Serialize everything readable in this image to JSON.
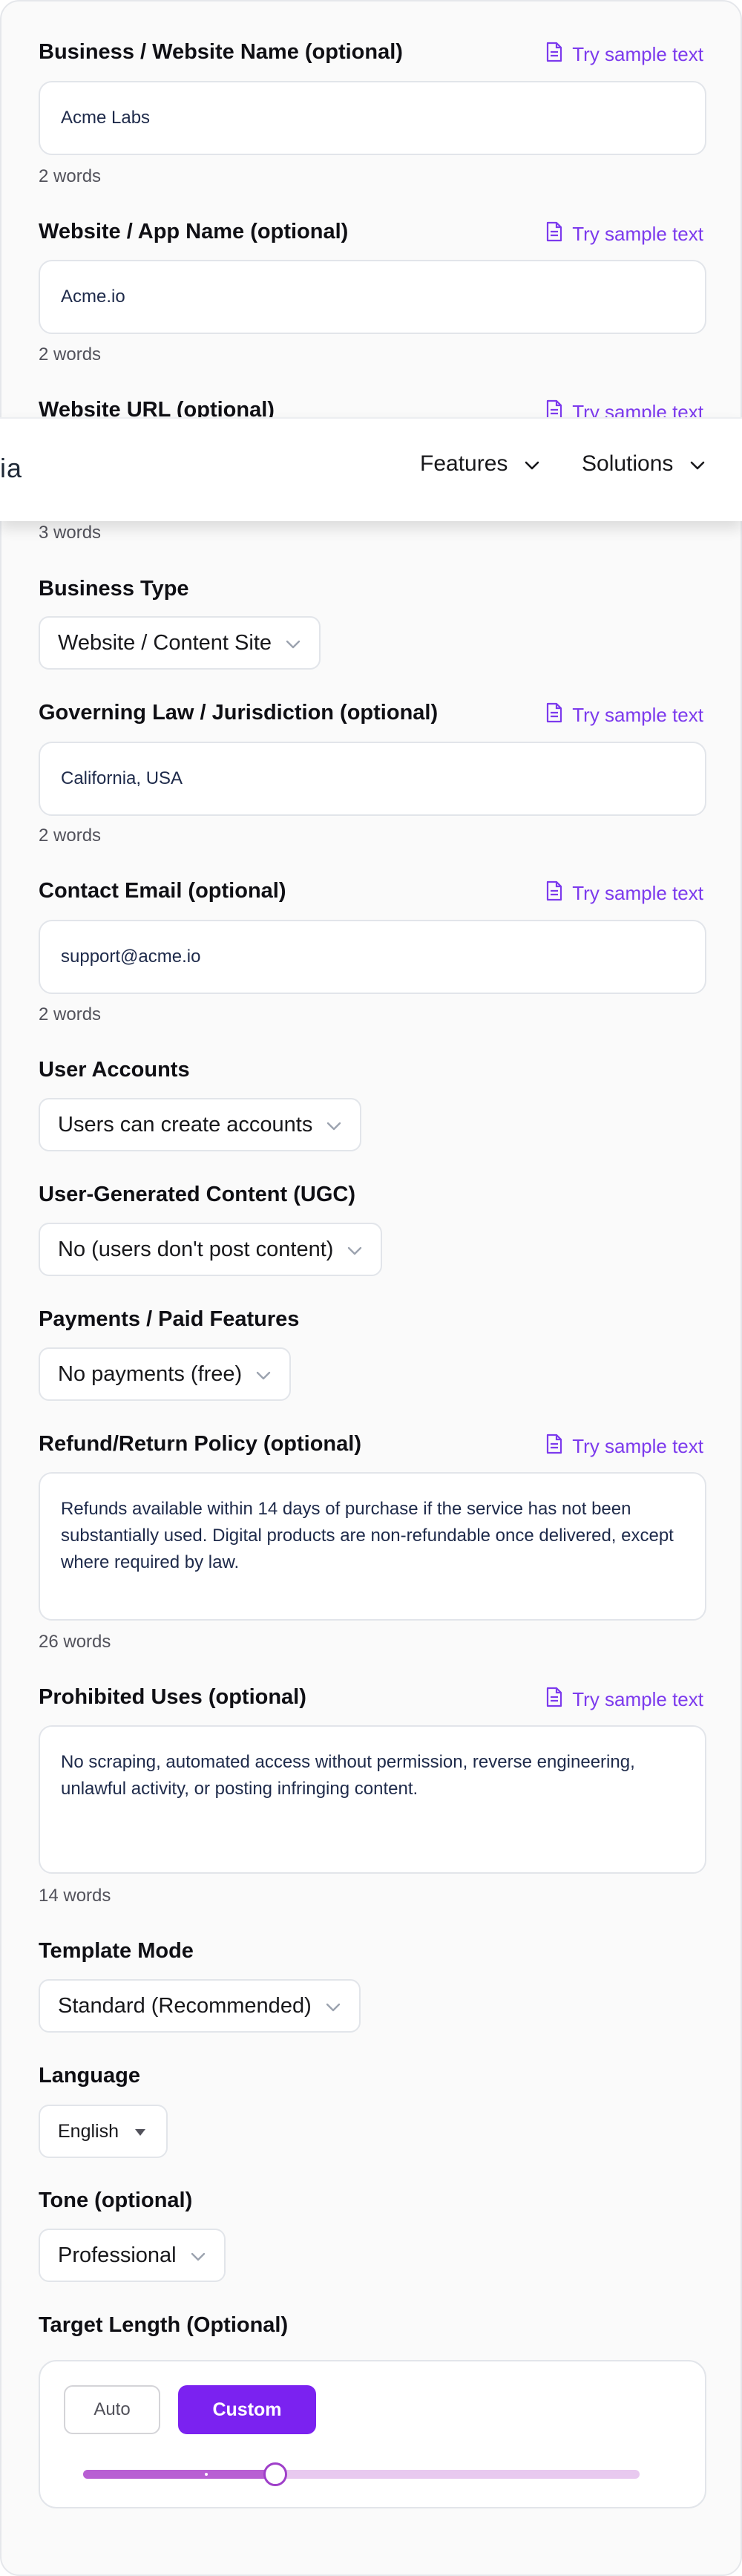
{
  "sample_link_label": "Try sample text",
  "accent_color": "#7c3aed",
  "fields": {
    "business_name": {
      "label": "Business / Website Name (optional)",
      "value": "Acme Labs",
      "words": "2 words"
    },
    "app_name": {
      "label": "Website / App Name (optional)",
      "value": "Acme.io",
      "words": "2 words"
    },
    "website_url": {
      "label": "Website URL (optional)",
      "words": "3 words"
    },
    "business_type": {
      "label": "Business Type",
      "value": "Website / Content Site"
    },
    "governing_law": {
      "label": "Governing Law / Jurisdiction (optional)",
      "value": "California, USA",
      "words": "2 words"
    },
    "contact_email": {
      "label": "Contact Email (optional)",
      "value": "support@acme.io",
      "words": "2 words"
    },
    "user_accounts": {
      "label": "User Accounts",
      "value": "Users can create accounts"
    },
    "ugc": {
      "label": "User-Generated Content (UGC)",
      "value": "No (users don't post content)"
    },
    "payments": {
      "label": "Payments / Paid Features",
      "value": "No payments (free)"
    },
    "refund_policy": {
      "label": "Refund/Return Policy (optional)",
      "value": "Refunds available within 14 days of purchase if the service has not been substantially used. Digital products are non-refundable once delivered, except where required by law.",
      "words": "26 words"
    },
    "prohibited_uses": {
      "label": "Prohibited Uses (optional)",
      "value": "No scraping, automated access without permission, reverse engineering, unlawful activity, or posting infringing content.",
      "words": "14 words"
    },
    "template_mode": {
      "label": "Template Mode",
      "value": "Standard (Recommended)"
    },
    "language": {
      "label": "Language",
      "value": "English"
    },
    "tone": {
      "label": "Tone (optional)",
      "value": "Professional"
    },
    "target_length": {
      "label": "Target Length (Optional)",
      "auto_label": "Auto",
      "custom_label": "Custom",
      "selected": "Custom",
      "slider_fraction": 0.345
    }
  },
  "nav": {
    "brand_fragment": "ia",
    "items": [
      {
        "label": "Features",
        "icon": "chevron-down-icon"
      },
      {
        "label": "Solutions",
        "icon": "chevron-down-icon"
      }
    ]
  }
}
